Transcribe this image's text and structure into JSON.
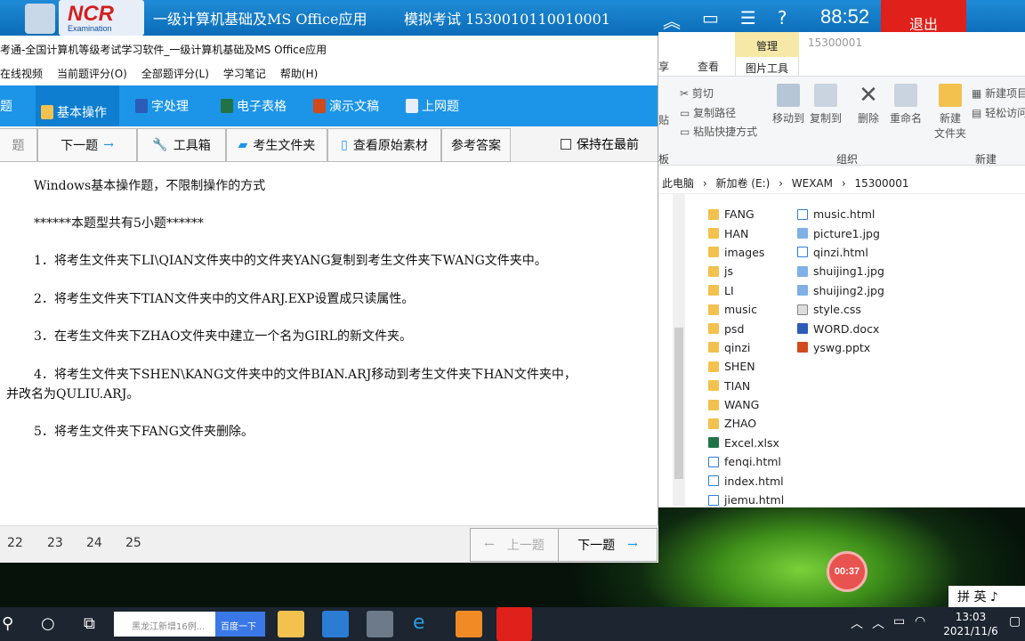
{
  "topbar": {
    "title": "一级计算机基础及MS Office应用",
    "exam": "模拟考试 1530010110010001",
    "timer": "88:52",
    "exit_label": "退出",
    "logo_text": "NCR",
    "logo_sub": "Examination"
  },
  "explorer": {
    "manage_tab": "管理",
    "folder_title": "15300001",
    "tabs": [
      "享",
      "查看"
    ],
    "picture_tools": "图片工具",
    "ribbon": {
      "cut": "剪切",
      "copy_path": "复制路径",
      "paste_shortcut": "粘贴快捷方式",
      "paste": "贴",
      "move_to": "移动到",
      "copy_to": "复制到",
      "delete": "删除",
      "rename": "重命名",
      "new_folder": "新建\n文件夹",
      "new_item": "新建项目",
      "easy_access": "轻松访问",
      "group_clipboard": "板",
      "group_organize": "组织",
      "group_new": "新建"
    },
    "breadcrumb": [
      "此电脑",
      "新加卷 (E:)",
      "WEXAM",
      "15300001"
    ],
    "col1": [
      {
        "name": "FANG",
        "type": "folder"
      },
      {
        "name": "HAN",
        "type": "folder"
      },
      {
        "name": "images",
        "type": "folder"
      },
      {
        "name": "js",
        "type": "folder"
      },
      {
        "name": "LI",
        "type": "folder"
      },
      {
        "name": "music",
        "type": "folder"
      },
      {
        "name": "psd",
        "type": "folder"
      },
      {
        "name": "qinzi",
        "type": "folder"
      },
      {
        "name": "SHEN",
        "type": "folder"
      },
      {
        "name": "TIAN",
        "type": "folder"
      },
      {
        "name": "WANG",
        "type": "folder"
      },
      {
        "name": "ZHAO",
        "type": "folder"
      },
      {
        "name": "Excel.xlsx",
        "type": "xlsx"
      },
      {
        "name": "fenqi.html",
        "type": "html"
      },
      {
        "name": "index.html",
        "type": "html"
      },
      {
        "name": "jiemu.html",
        "type": "html"
      }
    ],
    "col2": [
      {
        "name": "music.html",
        "type": "html"
      },
      {
        "name": "picture1.jpg",
        "type": "img"
      },
      {
        "name": "qinzi.html",
        "type": "html"
      },
      {
        "name": "shuijing1.jpg",
        "type": "img"
      },
      {
        "name": "shuijing2.jpg",
        "type": "img"
      },
      {
        "name": "style.css",
        "type": "css"
      },
      {
        "name": "WORD.docx",
        "type": "docx"
      },
      {
        "name": "yswg.pptx",
        "type": "pptx"
      }
    ]
  },
  "main": {
    "window_title": "考通-全国计算机等级考试学习软件_一级计算机基础及MS Office应用",
    "menu": [
      "在线视频",
      "当前题评分(O)",
      "全部题评分(L)",
      "学习笔记",
      "帮助(H)"
    ],
    "menu_prefix": "",
    "categories": [
      {
        "label": "题",
        "color": "transparent"
      },
      {
        "label": "基本操作",
        "color": "#f2c14e"
      },
      {
        "label": "字处理",
        "color": "#2b5cb8"
      },
      {
        "label": "电子表格",
        "color": "#217346"
      },
      {
        "label": "演示文稿",
        "color": "#d04a1e"
      },
      {
        "label": "上网题",
        "color": "#e8eef7"
      }
    ],
    "tools": {
      "prev_stub": "题",
      "next": "下一题",
      "toolbox": "工具箱",
      "exam_folder": "考生文件夹",
      "view_material": "查看原始素材",
      "answer": "参考答案",
      "keep_top": "保持在最前"
    },
    "content": {
      "intro": "Windows基本操作题，不限制操作的方式",
      "count": "******本题型共有5小题******",
      "q1": "1．将考生文件夹下LI\\QIAN文件夹中的文件夹YANG复制到考生文件夹下WANG文件夹中。",
      "q2": "2．将考生文件夹下TIAN文件夹中的文件ARJ.EXP设置成只读属性。",
      "q3": "3．在考生文件夹下ZHAO文件夹中建立一个名为GIRL的新文件夹。",
      "q4a": "4．将考生文件夹下SHEN\\KANG文件夹中的文件BIAN.ARJ移动到考生文件夹下HAN文件夹中，",
      "q4b": "并改名为QULIU.ARJ。",
      "q5": "5．将考生文件夹下FANG文件夹删除。"
    },
    "bottom": {
      "nums": [
        "22",
        "23",
        "24",
        "25"
      ],
      "prev": "上一题",
      "next": "下一题"
    }
  },
  "rec": "00:37",
  "ime": "拼 英 ♪",
  "taskbar": {
    "search_placeholder": "黑龙江新增16例...",
    "baidu": "百度一下",
    "time": "13:03",
    "date": "2021/11/6"
  }
}
